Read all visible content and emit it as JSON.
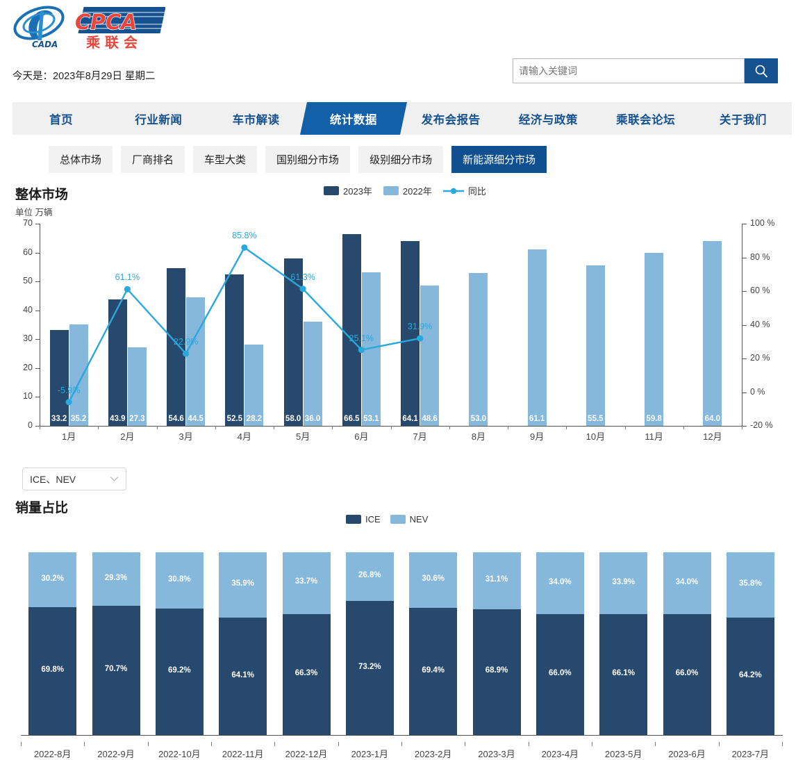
{
  "header": {
    "logo_text_main": "CPCA",
    "logo_text_sub": "乘 联 会",
    "logo_text_cada": "CADA",
    "today": "今天是：2023年8月29日 星期二",
    "search_placeholder": "请输入关键词",
    "search_value": "",
    "search_value2": "",
    "search_icon": "search-icon"
  },
  "nav": {
    "items": [
      {
        "label": "首页",
        "active": false
      },
      {
        "label": "行业新闻",
        "active": false
      },
      {
        "label": "车市解读",
        "active": false
      },
      {
        "label": "统计数据",
        "active": true
      },
      {
        "label": "发布会报告",
        "active": false
      },
      {
        "label": "经济与政策",
        "active": false
      },
      {
        "label": "乘联会论坛",
        "active": false
      },
      {
        "label": "关于我们",
        "active": false
      }
    ]
  },
  "subtabs": {
    "items": [
      {
        "label": "总体市场",
        "active": false
      },
      {
        "label": "厂商排名",
        "active": false
      },
      {
        "label": "车型大类",
        "active": false
      },
      {
        "label": "国别细分市场",
        "active": false
      },
      {
        "label": "级别细分市场",
        "active": false
      },
      {
        "label": "新能源细分市场",
        "active": true
      }
    ]
  },
  "section1": {
    "title": "整体市场",
    "unit": "单位 万辆",
    "legend": [
      {
        "label": "2023年",
        "color": "#27496d",
        "type": "bar"
      },
      {
        "label": "2022年",
        "color": "#85b8db",
        "type": "bar"
      },
      {
        "label": "同比",
        "color": "#29a8dd",
        "type": "line"
      }
    ]
  },
  "dropdown": {
    "value": "ICE、NEV",
    "caret": "chevron-down-icon"
  },
  "section2": {
    "title": "销量占比",
    "legend": [
      {
        "label": "ICE",
        "color": "#27496d"
      },
      {
        "label": "NEV",
        "color": "#85b8db"
      }
    ]
  },
  "chart_data": [
    {
      "type": "bar",
      "title": "整体市场",
      "subtitle": "单位 万辆",
      "xlabel": "",
      "ylabel": "万辆",
      "ylim": [
        0,
        70
      ],
      "y2lim": [
        -20,
        100
      ],
      "y2label": "%",
      "yticks": [
        0,
        10,
        20,
        30,
        40,
        50,
        60,
        70
      ],
      "y2ticks": [
        "-20 %",
        "0 %",
        "20 %",
        "40 %",
        "60 %",
        "80 %",
        "100 %"
      ],
      "grid": false,
      "legend_position": "top-right",
      "categories": [
        "1月",
        "2月",
        "3月",
        "4月",
        "5月",
        "6月",
        "7月",
        "8月",
        "9月",
        "10月",
        "11月",
        "12月"
      ],
      "series": [
        {
          "name": "2023年",
          "color": "#27496d",
          "values": [
            33.2,
            43.9,
            54.6,
            52.5,
            58.0,
            66.5,
            64.1,
            null,
            null,
            null,
            null,
            null
          ]
        },
        {
          "name": "2022年",
          "color": "#85b8db",
          "values": [
            35.2,
            27.3,
            44.5,
            28.2,
            36.0,
            53.1,
            48.6,
            53.0,
            61.1,
            55.5,
            59.8,
            64.0
          ]
        },
        {
          "name": "同比",
          "color": "#29a8dd",
          "type": "line",
          "axis": "right",
          "values": [
            -5.9,
            61.1,
            22.9,
            85.8,
            61.3,
            25.1,
            31.9,
            null,
            null,
            null,
            null,
            null
          ],
          "labels": [
            "-5.9%",
            "61.1%",
            "22.9%",
            "85.8%",
            "61.3%",
            "25.1%",
            "31.9%"
          ]
        }
      ]
    },
    {
      "type": "bar",
      "stacked": true,
      "title": "销量占比",
      "xlabel": "",
      "ylabel": "",
      "ylim": [
        0,
        100
      ],
      "grid": false,
      "legend_position": "top-center",
      "categories": [
        "2022-8月",
        "2022-9月",
        "2022-10月",
        "2022-11月",
        "2022-12月",
        "2023-1月",
        "2023-2月",
        "2023-3月",
        "2023-4月",
        "2023-5月",
        "2023-6月",
        "2023-7月"
      ],
      "series": [
        {
          "name": "ICE",
          "color": "#27496d",
          "values": [
            69.8,
            70.7,
            69.2,
            64.1,
            66.3,
            73.2,
            69.4,
            68.9,
            66.0,
            66.1,
            66.0,
            64.2
          ],
          "labels": [
            "69.8%",
            "70.7%",
            "69.2%",
            "64.1%",
            "66.3%",
            "73.2%",
            "69.4%",
            "68.9%",
            "66.0%",
            "66.1%",
            "66.0%",
            "64.2%"
          ]
        },
        {
          "name": "NEV",
          "color": "#85b8db",
          "values": [
            30.2,
            29.3,
            30.8,
            35.9,
            33.7,
            26.8,
            30.6,
            31.1,
            34.0,
            33.9,
            34.0,
            35.8
          ],
          "labels": [
            "30.2%",
            "29.3%",
            "30.8%",
            "35.9%",
            "33.7%",
            "26.8%",
            "30.6%",
            "31.1%",
            "34.0%",
            "33.9%",
            "34.0%",
            "35.8%"
          ]
        }
      ]
    }
  ]
}
